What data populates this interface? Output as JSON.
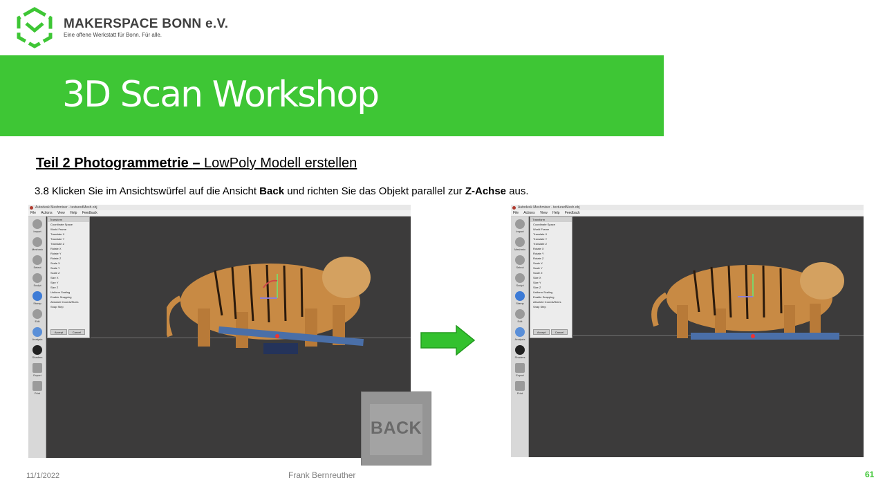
{
  "header": {
    "org_name": "MAKERSPACE BONN e.V.",
    "tagline": "Eine offene Werkstatt für Bonn. Für alle.",
    "title": "3D Scan Workshop"
  },
  "section": {
    "part": "Teil 2  Photogrammetrie ",
    "dash": " – ",
    "topic": "LowPoly Modell erstellen"
  },
  "instruction": {
    "prefix": "3.8 Klicken Sie im Ansichtswürfel auf die Ansicht ",
    "back_word": "Back",
    "middle": " und richten Sie das Objekt parallel zur ",
    "axis_word": "Z-Achse",
    "suffix": " aus."
  },
  "app_window": {
    "title": "Autodesk Meshmixer - texturedMesh.obj",
    "menu": [
      "File",
      "Actions",
      "View",
      "Help",
      "Feedback"
    ],
    "tools": [
      "Import",
      "Meshmix",
      "Select",
      "Sculpt",
      "Stamp",
      "Edit",
      "Analysis",
      "Shaders",
      "Export",
      "Print"
    ],
    "panel": {
      "header": "Transform",
      "coordinate_label": "Coordinate Space",
      "coordinate_value": "World Frame",
      "fields": [
        "Translate X",
        "Translate Y",
        "Translate Z",
        "Rotate X",
        "Rotate Y",
        "Rotate Z",
        "Scale X",
        "Scale Y",
        "Scale Z",
        "Size X",
        "Size Y",
        "Size Z"
      ],
      "uniform_scaling": "Uniform Scaling",
      "enable_snapping": "Enable Snapping",
      "absolute_coords": "Absolute Coords/Sizes",
      "snap_step": "Snap Step",
      "accept": "Accept",
      "cancel": "Cancel"
    }
  },
  "view_cube": {
    "label": "BACK"
  },
  "footer": {
    "date": "11/1/2022",
    "author": "Frank Bernreuther",
    "page": "61"
  },
  "colors": {
    "brand_green": "#3ec635",
    "viewport_bg": "#3c3b3b",
    "footer_gray": "#7f7f7f"
  }
}
